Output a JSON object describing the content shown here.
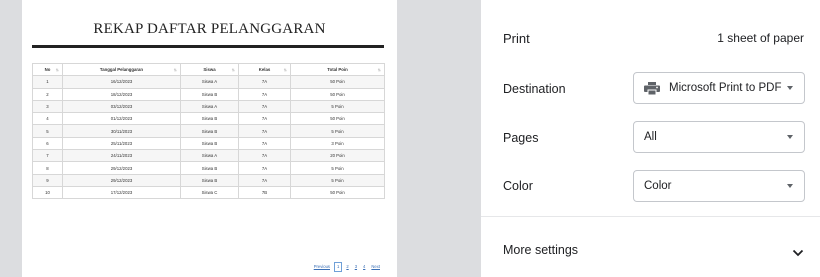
{
  "document": {
    "title": "REKAP DAFTAR PELANGGARAN",
    "columns": [
      "No",
      "Tanggal Pelanggaran",
      "Siswa",
      "Kelas",
      "Total Poin"
    ],
    "rows": [
      [
        "1",
        "16/12/2023",
        "Siswa A",
        "7A",
        "50 Poin"
      ],
      [
        "2",
        "18/12/2023",
        "Siswa B",
        "7A",
        "50 Poin"
      ],
      [
        "3",
        "03/12/2023",
        "Siswa A",
        "7A",
        "5 Poin"
      ],
      [
        "4",
        "01/12/2023",
        "Siswa B",
        "7A",
        "50 Poin"
      ],
      [
        "5",
        "30/11/2023",
        "Siswa B",
        "7A",
        "5 Poin"
      ],
      [
        "6",
        "25/11/2023",
        "Siswa B",
        "7A",
        "3 Poin"
      ],
      [
        "7",
        "24/11/2023",
        "Siswa A",
        "7A",
        "20 Poin"
      ],
      [
        "8",
        "29/12/2023",
        "Siswa B",
        "7A",
        "5 Poin"
      ],
      [
        "9",
        "29/12/2023",
        "Siswa B",
        "7A",
        "5 Poin"
      ],
      [
        "10",
        "17/12/2023",
        "Siswa C",
        "7B",
        "50 Poin"
      ]
    ],
    "pagination": {
      "previous": "Previous",
      "pages": [
        "1",
        "2",
        "3",
        "4"
      ],
      "next": "Next",
      "active": "1"
    }
  },
  "print": {
    "title": "Print",
    "sheets": "1 sheet of paper",
    "destination_label": "Destination",
    "destination_value": "Microsoft Print to PDF",
    "pages_label": "Pages",
    "pages_value": "All",
    "color_label": "Color",
    "color_value": "Color",
    "more_settings": "More settings"
  },
  "icons": {
    "printer": "printer-icon",
    "dropdown": "caret-down-icon",
    "expand": "chevron-down-icon",
    "sort": "sort-arrows-icon"
  },
  "colors": {
    "preview_background": "#dcdde0",
    "link": "#3a6fb6",
    "text": "#202124"
  }
}
